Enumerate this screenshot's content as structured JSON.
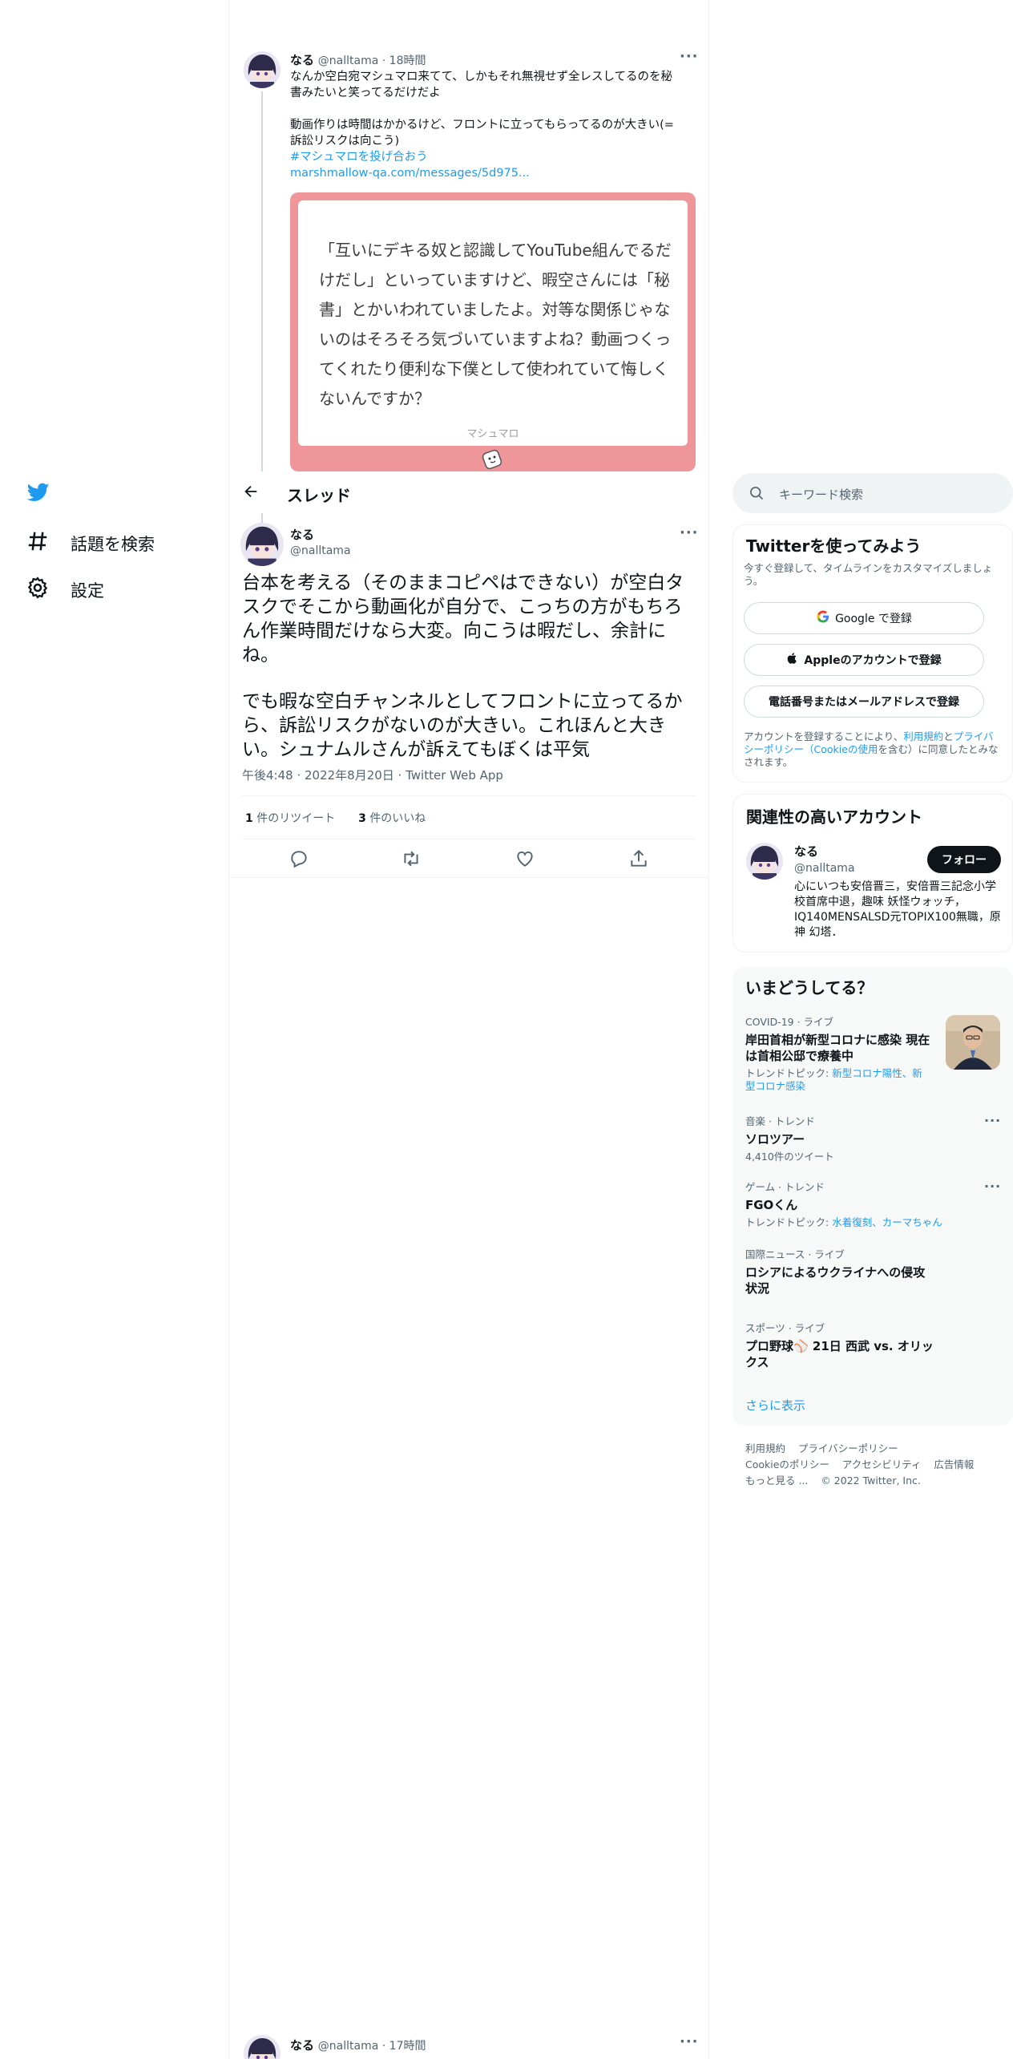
{
  "nav": {
    "explore_label": "話題を検索",
    "settings_label": "設定"
  },
  "top_tweet": {
    "name": "なる",
    "handle_time": "@nalltama · 18時間",
    "line1": "なんか空白宛マシュマロ来てて、しかもそれ無視せず全レスしてるのを秘",
    "line2": "書みたいと笑ってるだけだよ",
    "line3": "動画作りは時間はかかるけど、フロントに立ってもらってるのが大きい(=",
    "line4": "訴訟リスクは向こう)",
    "hashtag": "#マシュマロを投げ合おう",
    "url": "marshmallow-qa.com/messages/5d975...",
    "card_text": "「互いにデキる奴と認識してYouTube組んでるだけだし」といっていますけど、暇空さんには「秘書」とかいわれていましたよ。対等な関係じゃないのはそろそろ気づいていますよね？動画つくってくれたり便利な下僕として使われていて悔しくないんですか？",
    "card_label": "マシュマロ"
  },
  "header": {
    "title": "スレッド"
  },
  "main_tweet": {
    "name": "なる",
    "handle": "@nalltama",
    "text_p1": "台本を考える（そのままコピペはできない）が空白タスクでそこから動画化が自分で、こっちの方がもちろん作業時間だけなら大変。向こうは暇だし、余計にね。",
    "text_p2": "でも暇な空白チャンネルとしてフロントに立ってるから、訴訟リスクがないのが大きい。これほんと大きい。シュナムルさんが訴えてもぼくは平気",
    "meta": "午後4:48 · 2022年8月20日 · Twitter Web App",
    "retweets_count": "1",
    "retweets_label": "件のリツイート",
    "likes_count": "3",
    "likes_label": "件のいいね"
  },
  "bottom_tweet": {
    "name": "なる",
    "handle_time": "@nalltama · 17時間"
  },
  "search": {
    "placeholder": "キーワード検索"
  },
  "signup": {
    "title": "Twitterを使ってみよう",
    "subtitle": "今すぐ登録して、タイムラインをカスタマイズしましょう。",
    "google": "Google で登録",
    "apple": "Appleのアカウントで登録",
    "phone": "電話番号またはメールアドレスで登録",
    "terms_pre": "アカウントを登録することにより、",
    "terms_link": "利用規約",
    "terms_and": "と",
    "privacy_link": "プライバシーポリシー",
    "cookie_pre": "（",
    "cookie_link": "Cookieの使用",
    "terms_post": "を含む）に同意したとみなされます。"
  },
  "relevant": {
    "title": "関連性の高いアカウント",
    "name": "なる",
    "handle": "@nalltama",
    "follow": "フォロー",
    "bio": "心にいつも安倍晋三，安倍晋三記念小学校首席中退，趣味 妖怪ウォッチ，IQ140MENSALSD元TOPIX100無職，原神 幻塔．"
  },
  "trends": {
    "title": "いまどうしてる？",
    "items": [
      {
        "category": "COVID-19 · ライブ",
        "title": "岸田首相が新型コロナに感染 現在は首相公邸で療養中",
        "sub_pre": "トレンドトピック: ",
        "sub_link": "新型コロナ陽性、新型コロナ感染"
      },
      {
        "category": "音楽 · トレンド",
        "title": "ソロツアー",
        "sub_pre": "4,410件のツイート",
        "sub_link": ""
      },
      {
        "category": "ゲーム · トレンド",
        "title": "FGOくん",
        "sub_pre": "トレンドトピック: ",
        "sub_link": "水着復刻、カーマちゃん"
      },
      {
        "category": "国際ニュース · ライブ",
        "title": "ロシアによるウクライナへの侵攻状況",
        "sub_pre": "",
        "sub_link": ""
      },
      {
        "category": "スポーツ · ライブ",
        "title": "プロ野球⚾ 21日 西武 vs. オリックス",
        "sub_pre": "",
        "sub_link": ""
      }
    ],
    "show_more": "さらに表示"
  },
  "footer": {
    "terms": "利用規約",
    "privacy": "プライバシーポリシー",
    "cookie": "Cookieのポリシー",
    "accessibility": "アクセシビリティ",
    "ads": "広告情報",
    "more": "もっと見る ...",
    "copyright": "© 2022 Twitter, Inc."
  },
  "colors": {
    "accent": "#1d9bf0",
    "marshmallow": "#ef969a",
    "text": "#0f1419",
    "muted": "#536471"
  }
}
